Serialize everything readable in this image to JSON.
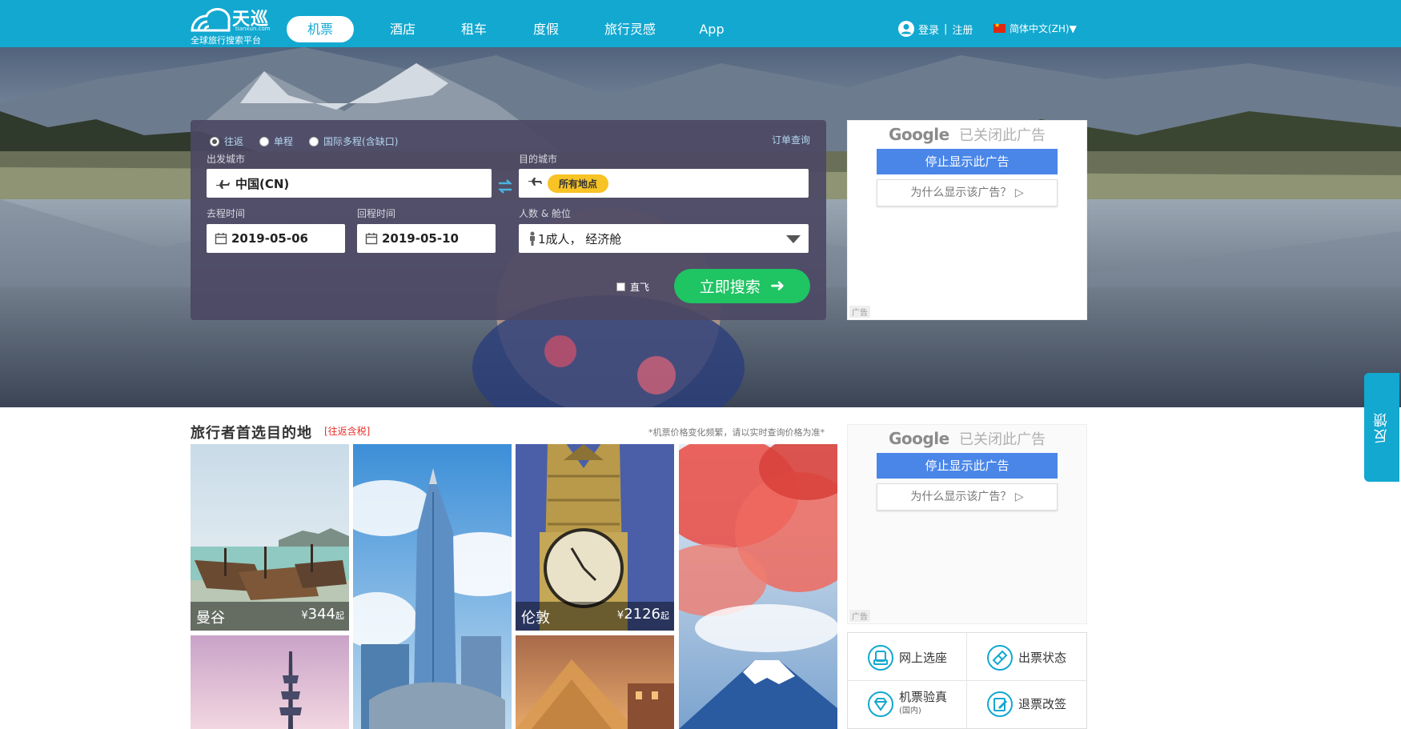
{
  "header": {
    "logo_name": "天巡",
    "logo_domain": "tianxun.com",
    "logo_tagline": "全球旅行搜索平台",
    "nav": [
      {
        "label": "机票"
      },
      {
        "label": "酒店"
      },
      {
        "label": "租车"
      },
      {
        "label": "度假"
      },
      {
        "label": "旅行灵感"
      },
      {
        "label": "App"
      }
    ],
    "login_label": "登录",
    "register_label": "注册",
    "login_separator": "|",
    "language": "简体中文(ZH)▼"
  },
  "search": {
    "trip_types": [
      "往返",
      "单程",
      "国际多程(含缺口)"
    ],
    "selected_trip_type": "往返",
    "order_query": "订单查询",
    "origin_label": "出发城市",
    "origin_value": "中国(CN)",
    "destination_label": "目的城市",
    "destination_pill": "所有地点",
    "depart_label": "去程时间",
    "depart_value": "2019-05-06",
    "return_label": "回程时间",
    "return_value": "2019-05-10",
    "pax_label": "人数 & 舱位",
    "pax_value": "1成人， 经济舱",
    "direct_label": "直飞",
    "search_button": "立即搜索"
  },
  "ads": [
    {
      "brand": "Google",
      "closed": "已关闭此广告",
      "stop": "停止显示此广告",
      "why": "为什么显示该广告？ ▷",
      "label": "广告"
    },
    {
      "brand": "Google",
      "closed": "已关闭此广告",
      "stop": "停止显示此广告",
      "why": "为什么显示该广告？ ▷",
      "label": "广告"
    }
  ],
  "destinations": {
    "title": "旅行者首选目的地",
    "tag": "[往返含税]",
    "note": "*机票价格变化频繁，请以实时查询价格为准*",
    "tiles": [
      {
        "city": "曼谷",
        "currency": "¥",
        "price": "344",
        "suffix": "起"
      },
      {
        "city": "伦敦",
        "currency": "¥",
        "price": "2126",
        "suffix": "起"
      }
    ]
  },
  "services": [
    {
      "label": "网上选座",
      "sub": ""
    },
    {
      "label": "出票状态",
      "sub": ""
    },
    {
      "label": "机票验真",
      "sub": "(国内)"
    },
    {
      "label": "退票改签",
      "sub": ""
    }
  ],
  "feedback_label": "反馈",
  "colors": {
    "brand": "#12a8d0",
    "search_button": "#1fc463",
    "pill": "#f7c325",
    "ad_button": "#4a86e8",
    "tag_red": "#e8302a"
  }
}
